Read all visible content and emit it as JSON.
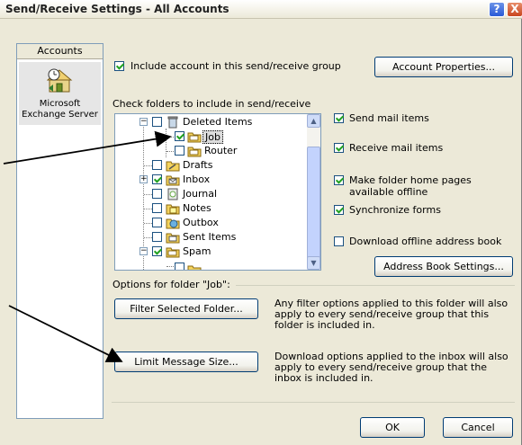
{
  "window": {
    "title": "Send/Receive Settings - All Accounts",
    "help_glyph": "?",
    "close_glyph": "X"
  },
  "accounts": {
    "header": "Accounts",
    "item_label_line1": "Microsoft",
    "item_label_line2": "Exchange Server",
    "item_icon": "exchange-server-icon"
  },
  "include_account": {
    "label": "Include account in this send/receive group",
    "checked": true
  },
  "account_properties_button": "Account Properties...",
  "folders_label": "Check folders to include in send/receive",
  "folder_tree": [
    {
      "label": "Deleted Items",
      "checked": false,
      "expander": "-",
      "icon": "trash-folder-icon",
      "selected": false
    },
    {
      "label": "Job",
      "checked": true,
      "expander": "",
      "icon": "folder-icon",
      "selected": true
    },
    {
      "label": "Router",
      "checked": false,
      "expander": "",
      "icon": "folder-icon",
      "selected": false
    },
    {
      "label": "Drafts",
      "checked": false,
      "expander": "",
      "icon": "drafts-folder-icon",
      "selected": false
    },
    {
      "label": "Inbox",
      "checked": true,
      "expander": "+",
      "icon": "inbox-folder-icon",
      "selected": false
    },
    {
      "label": "Journal",
      "checked": false,
      "expander": "",
      "icon": "journal-icon",
      "selected": false
    },
    {
      "label": "Notes",
      "checked": false,
      "expander": "",
      "icon": "notes-icon",
      "selected": false
    },
    {
      "label": "Outbox",
      "checked": false,
      "expander": "",
      "icon": "outbox-folder-icon",
      "selected": false
    },
    {
      "label": "Sent Items",
      "checked": false,
      "expander": "",
      "icon": "sent-folder-icon",
      "selected": false
    },
    {
      "label": "Spam",
      "checked": true,
      "expander": "-",
      "icon": "folder-icon",
      "selected": false
    }
  ],
  "options": {
    "send_mail": {
      "label": "Send mail items",
      "checked": true
    },
    "receive_mail": {
      "label": "Receive mail items",
      "checked": true
    },
    "home_pages": {
      "label": "Make folder home pages available offline",
      "checked": true
    },
    "sync_forms": {
      "label": "Synchronize forms",
      "checked": true
    },
    "offline_ab": {
      "label": "Download offline address book",
      "checked": false
    }
  },
  "address_book_button": "Address Book Settings...",
  "folder_options_label": "Options for folder \"Job\":",
  "filter_button": "Filter Selected Folder...",
  "filter_desc": "Any filter options applied to this folder will also apply to every send/receive group that this folder is included in.",
  "limit_button": "Limit Message Size...",
  "limit_desc": "Download options applied to the inbox will also apply to every send/receive group that the inbox is included in.",
  "ok_button": "OK",
  "cancel_button": "Cancel",
  "colors": {
    "dialog_bg": "#ece9d8",
    "check_green": "#21a121",
    "button_border": "#003c74",
    "arrow": "#000000"
  }
}
